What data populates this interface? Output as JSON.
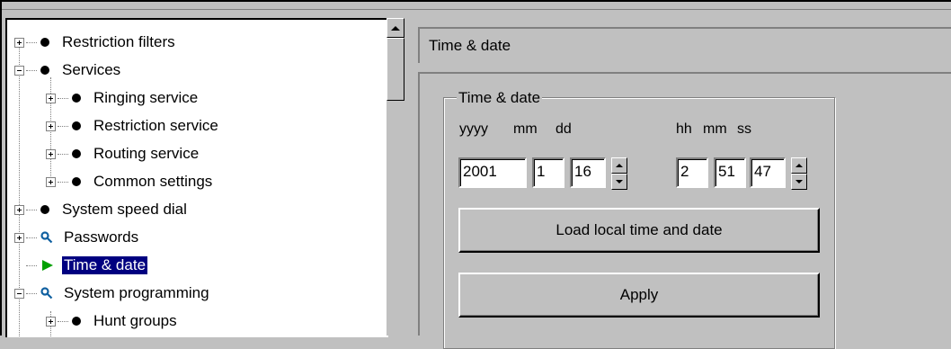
{
  "tree": {
    "items": [
      {
        "label": "Restriction filters",
        "expander": "plus",
        "icon": "bullet"
      },
      {
        "label": "Services",
        "expander": "minus",
        "icon": "bullet"
      },
      {
        "label": "Ringing service",
        "expander": "plus",
        "icon": "bullet"
      },
      {
        "label": "Restriction service",
        "expander": "plus",
        "icon": "bullet"
      },
      {
        "label": "Routing service",
        "expander": "plus",
        "icon": "bullet"
      },
      {
        "label": "Common settings",
        "expander": "plus",
        "icon": "bullet"
      },
      {
        "label": "System speed dial",
        "expander": "plus",
        "icon": "bullet"
      },
      {
        "label": "Passwords",
        "expander": "plus",
        "icon": "key-icon"
      },
      {
        "label": "Time & date",
        "expander": "none",
        "icon": "play-icon",
        "selected": true
      },
      {
        "label": "System programming",
        "expander": "minus",
        "icon": "key-icon"
      },
      {
        "label": "Hunt groups",
        "expander": "plus",
        "icon": "bullet"
      }
    ]
  },
  "panel": {
    "title": "Time & date",
    "group_title": "Time & date",
    "date_labels": {
      "yyyy": "yyyy",
      "mm": "mm",
      "dd": "dd"
    },
    "time_labels": {
      "hh": "hh",
      "mm": "mm",
      "ss": "ss"
    },
    "date_values": {
      "year": "2001",
      "month": "1",
      "day": "16"
    },
    "time_values": {
      "hour": "2",
      "minute": "51",
      "second": "47"
    },
    "load_button": "Load local time and date",
    "apply_button": "Apply"
  },
  "colors": {
    "selection": "#000080",
    "face": "#c0c0c0",
    "play_icon": "#00a000"
  }
}
